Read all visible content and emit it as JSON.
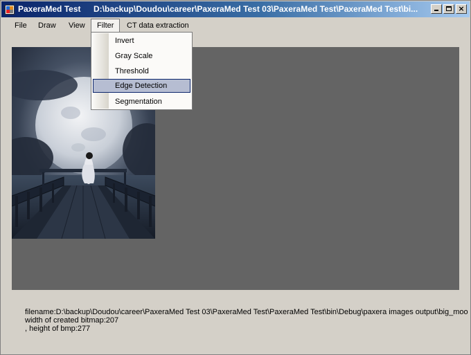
{
  "window": {
    "app_name": "PaxeraMed Test",
    "title_path": "D:\\backup\\Doudou\\career\\PaxeraMed Test 03\\PaxeraMed Test\\PaxeraMed Test\\bi..."
  },
  "menu": {
    "file": "File",
    "draw": "Draw",
    "view": "View",
    "filter": "Filter",
    "ct": "CT data extraction"
  },
  "filter_menu": {
    "items": [
      "Invert",
      "Gray Scale",
      "Threshold",
      "Edge Detection",
      "Segmentation"
    ],
    "highlighted": "Edge Detection"
  },
  "info": {
    "filename_line": "filename:D:\\backup\\Doudou\\career\\PaxeraMed Test 03\\PaxeraMed Test\\PaxeraMed Test\\bin\\Debug\\paxera images output\\big_moon",
    "width_line": "width of created bitmap:207",
    "height_line": ", height of bmp:277"
  },
  "colors": {
    "title_gradient_start": "#0a246a",
    "title_gradient_end": "#a6caf0",
    "canvas_bg": "#646464",
    "menu_highlight": "#b6bdd2",
    "window_bg": "#d4d0c8"
  },
  "icons": [
    "app-icon",
    "minimize-icon",
    "maximize-icon",
    "close-icon"
  ]
}
